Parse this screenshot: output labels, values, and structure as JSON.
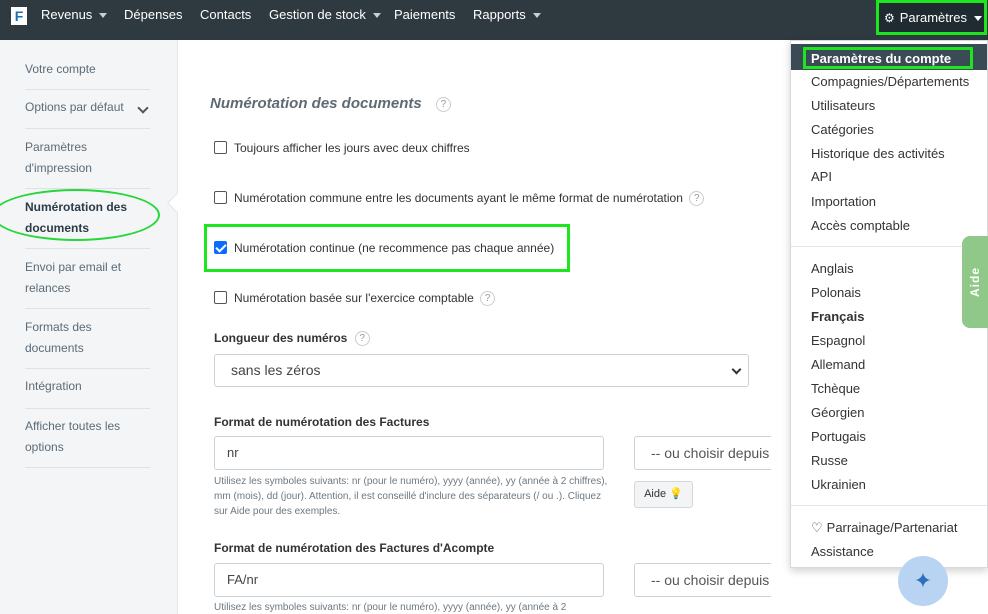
{
  "nav": {
    "logo": "F",
    "items": [
      {
        "label": "Revenus",
        "dropdown": true
      },
      {
        "label": "Dépenses",
        "dropdown": false
      },
      {
        "label": "Contacts",
        "dropdown": false
      },
      {
        "label": "Gestion de stock",
        "dropdown": true
      },
      {
        "label": "Paiements",
        "dropdown": false
      },
      {
        "label": "Rapports",
        "dropdown": true
      }
    ],
    "settings_label": "Paramètres"
  },
  "sidebar": {
    "items": [
      {
        "label": "Votre compte"
      },
      {
        "label": "Options par défaut"
      },
      {
        "label": "Paramètres d'impression"
      },
      {
        "label": "Numérotation des documents",
        "active": true
      },
      {
        "label": "Envoi par email et relances"
      },
      {
        "label": "Formats des documents"
      },
      {
        "label": "Intégration"
      },
      {
        "label": "Afficher toutes les options"
      }
    ]
  },
  "main": {
    "title": "Numérotation des documents",
    "checkboxes": [
      {
        "label": "Toujours afficher les jours avec deux chiffres",
        "checked": false
      },
      {
        "label": "Numérotation commune entre les documents ayant le même format de numérotation",
        "checked": false
      },
      {
        "label": "Numérotation continue (ne recommence pas chaque année)",
        "checked": true
      },
      {
        "label": "Numérotation basée sur l'exercice comptable",
        "checked": false
      }
    ],
    "length": {
      "label": "Longueur des numéros",
      "value": "sans les zéros"
    },
    "invoice_format": {
      "label": "Format de numérotation des Factures",
      "value": "nr",
      "choose": "-- ou choisir depuis",
      "hint": "Utilisez les symboles suivants: nr (pour le numéro), yyyy (année), yy (année à 2 chiffres), mm (mois), dd (jour). Attention, il est conseillé d'inclure des séparateurs (/ ou .). Cliquez sur Aide pour des exemples.",
      "help_button": "Aide"
    },
    "deposit_format": {
      "label": "Format de numérotation des Factures d'Acompte",
      "value": "FA/nr",
      "choose": "-- ou choisir depuis",
      "hint": "Utilisez les symboles suivants: nr (pour le numéro), yyyy (année), yy (année à 2"
    }
  },
  "dropdown": {
    "active": "Paramètres du compte",
    "group1": [
      "Compagnies/Départements",
      "Utilisateurs",
      "Catégories",
      "Historique des activités",
      "API",
      "Importation",
      "Accès comptable"
    ],
    "languages": [
      "Anglais",
      "Polonais",
      "Français",
      "Espagnol",
      "Allemand",
      "Tchèque",
      "Géorgien",
      "Portugais",
      "Russe",
      "Ukrainien"
    ],
    "selected_language": "Français",
    "referral": "Parrainage/Partenariat",
    "assistance": "Assistance"
  },
  "help_tab": "Aide",
  "colors": {
    "accent_green": "#1ee61e",
    "nav_bg": "#2f3a40",
    "checkbox_blue": "#0a6cff"
  }
}
